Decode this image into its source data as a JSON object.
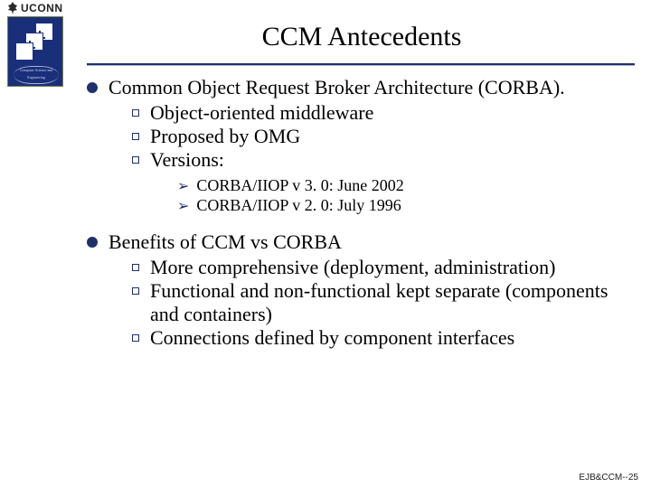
{
  "header": {
    "org": "UCONN",
    "seal_text": "Computer Science and Engineering",
    "title": "CCM Antecedents"
  },
  "content": {
    "items": [
      {
        "text": "Common Object Request  Broker Architecture (CORBA).",
        "sub": [
          {
            "text": "Object-oriented middleware"
          },
          {
            "text": "Proposed by OMG"
          },
          {
            "text": "Versions:",
            "sub": [
              {
                "text": "CORBA/IIOP v 3. 0: June 2002"
              },
              {
                "text": "CORBA/IIOP v 2. 0: July 1996"
              }
            ]
          }
        ]
      },
      {
        "text": "Benefits of CCM vs CORBA",
        "sub": [
          {
            "text": "More comprehensive (deployment, administration)"
          },
          {
            "text": "Functional and non-functional kept separate (components and containers)"
          },
          {
            "text": "Connections defined by component interfaces"
          }
        ]
      }
    ]
  },
  "footer": {
    "text": "EJB&CCM--25"
  }
}
